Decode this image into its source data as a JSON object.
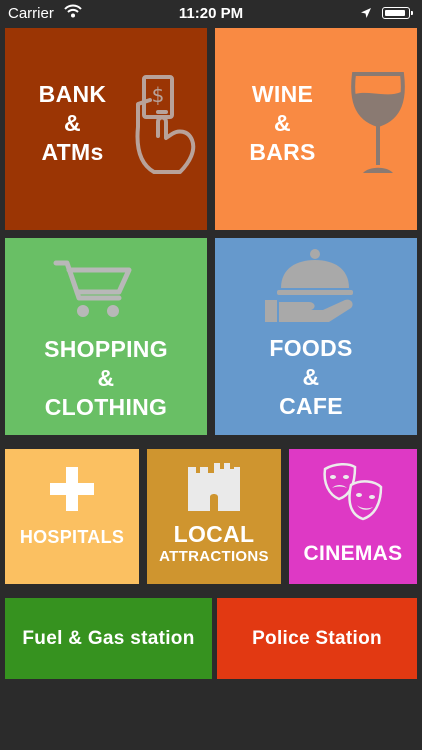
{
  "status_bar": {
    "carrier": "Carrier",
    "time": "11:20 PM"
  },
  "tiles": {
    "bank": {
      "line1": "BANK",
      "line2": "&",
      "line3": "ATMs",
      "color": "#9b3504"
    },
    "wine": {
      "line1": "WINE",
      "line2": "&",
      "line3": "BARS",
      "color": "#f98a43"
    },
    "shopping": {
      "line1": "SHOPPING",
      "line2": "&",
      "line3": "CLOTHING",
      "color": "#69bf65"
    },
    "foods": {
      "line1": "FOODS",
      "line2": "&",
      "line3": "CAFE",
      "color": "#6699cc"
    },
    "hospitals": {
      "label": "HOSPITALS",
      "color": "#fbc061"
    },
    "local": {
      "line1": "LOCAL",
      "line2": "ATTRACTIONS",
      "color": "#cf952f"
    },
    "cinemas": {
      "label": "CINEMAS",
      "color": "#de39c5"
    },
    "fuel": {
      "label": "Fuel & Gas station",
      "color": "#36921f"
    },
    "police": {
      "label": "Police Station",
      "color": "#e23912"
    }
  },
  "icons": {
    "bank": "hand-money-icon",
    "wine": "wine-glass-icon",
    "shopping": "shopping-cart-icon",
    "foods": "cloche-serving-icon",
    "hospitals": "medical-cross-icon",
    "local": "castle-icon",
    "cinemas": "theater-masks-icon"
  }
}
